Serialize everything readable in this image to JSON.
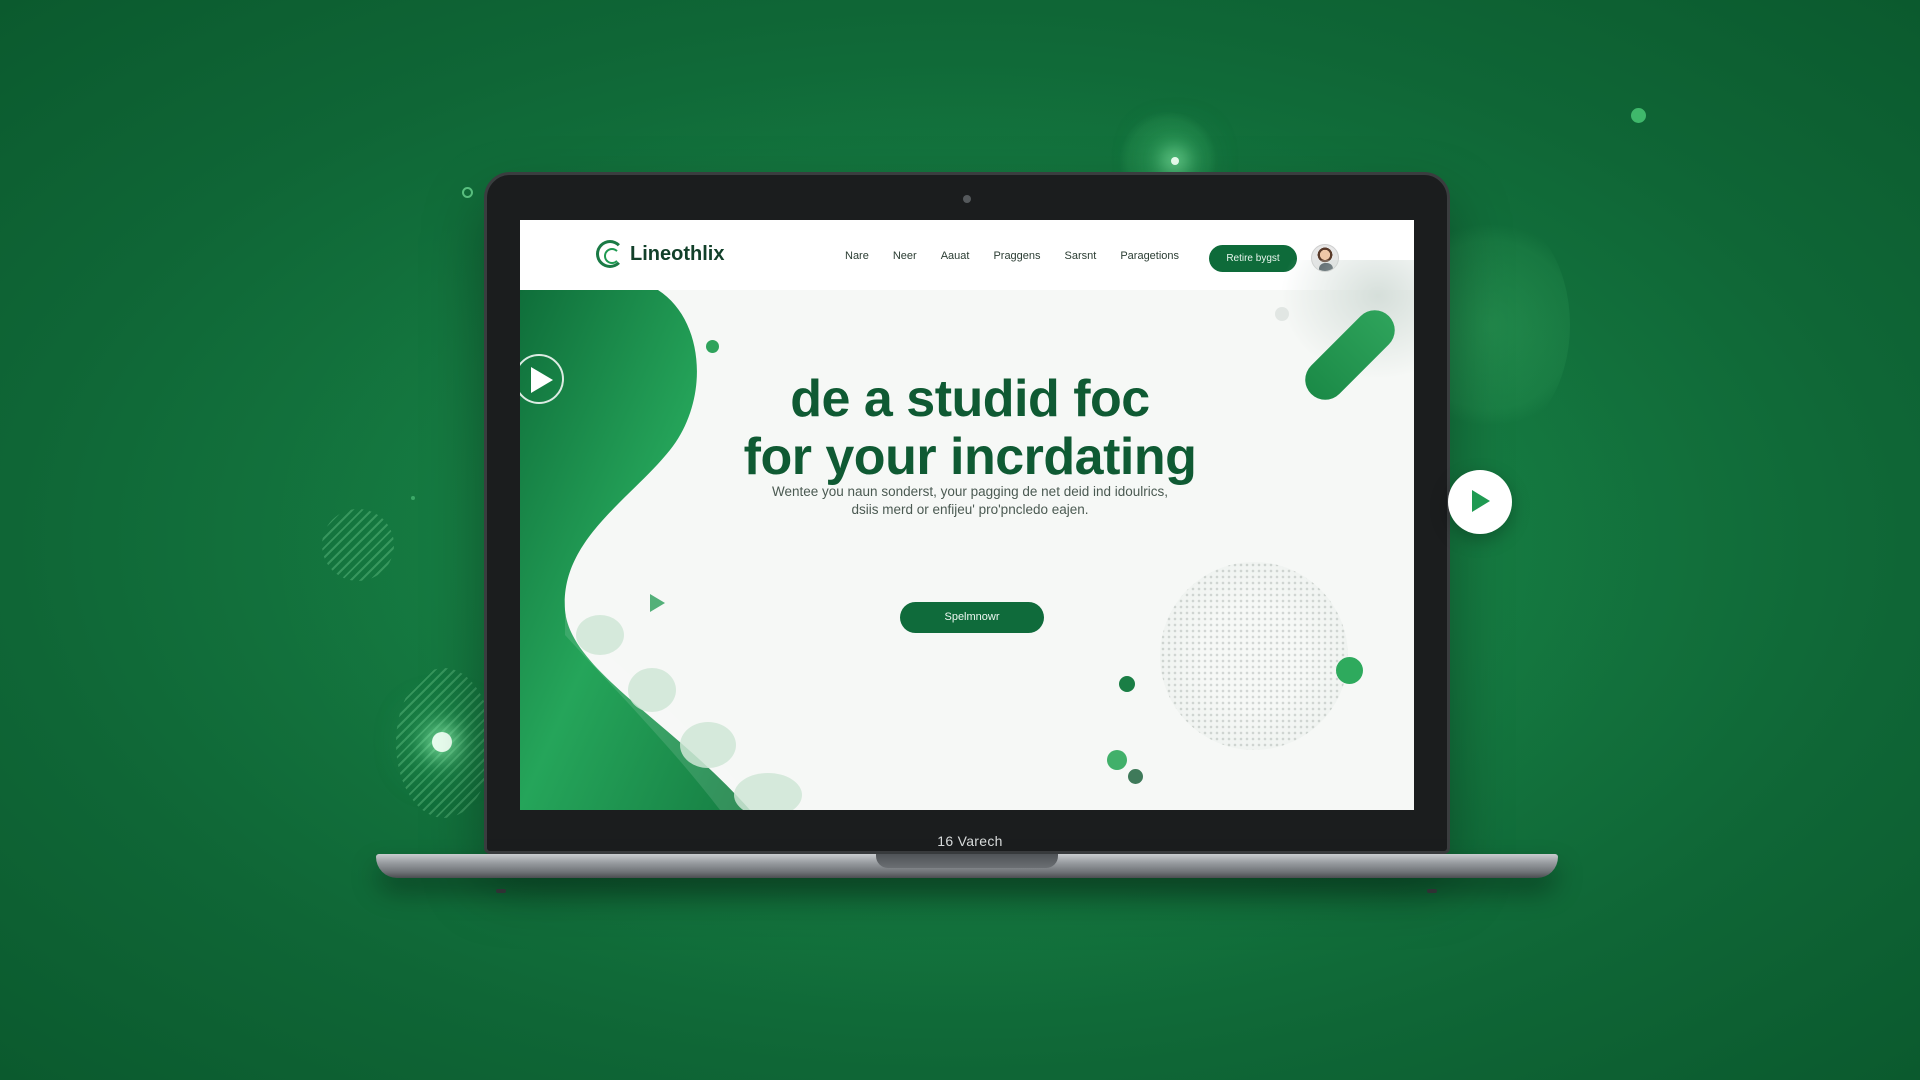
{
  "brand": {
    "name": "Lineothlix"
  },
  "nav": {
    "links": [
      "Nare",
      "Neer",
      "Aauat",
      "Praggens",
      "Sarsnt",
      "Paragetions"
    ],
    "cta_label": "Retire bygst"
  },
  "hero": {
    "headline_line1": "de a studid foc",
    "headline_line2": "for your incrdating",
    "subtext_line1": "Wentee you naun sonderst, your pagging de net deid ind idoulrics,",
    "subtext_line2": "dsiis merd or enfijeu' pro'pncledo eajen.",
    "cta_label": "Spelmnowr"
  },
  "laptop": {
    "bezel_label": "16 Varech"
  },
  "icons": {
    "logo": "swirl-logo-icon",
    "play_left": "play-icon",
    "play_float": "play-icon",
    "small_play": "play-triangle-icon"
  },
  "colors": {
    "background": "#157a41",
    "brand_dark": "#0f5a33",
    "accent": "#1f9a52",
    "button": "#0f6b3b"
  }
}
